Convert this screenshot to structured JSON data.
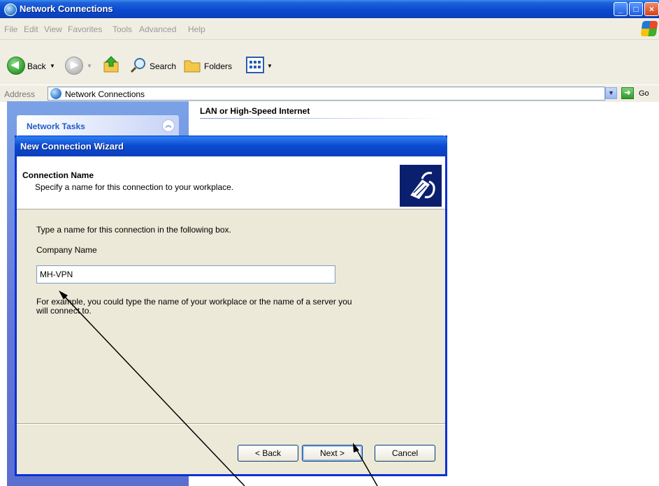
{
  "window": {
    "title": "Network Connections"
  },
  "menu": [
    "File",
    "Edit",
    "View",
    "Favorites",
    "Tools",
    "Advanced",
    "Help"
  ],
  "toolbar": {
    "back_label": "Back",
    "search_label": "Search",
    "folders_label": "Folders"
  },
  "address": {
    "label": "Address",
    "value": "Network Connections",
    "go_label": "Go"
  },
  "taskpane": {
    "header": "Network Tasks"
  },
  "content": {
    "section_heading": "LAN or High-Speed Internet"
  },
  "wizard": {
    "title": "New Connection Wizard",
    "header_title": "Connection Name",
    "header_subtitle": "Specify a name for this connection to your workplace.",
    "instruction": "Type a name for this connection in the following box.",
    "field_label": "Company Name",
    "field_value": "MH-VPN",
    "example_line1": "For example, you could type the name of your workplace or the name of a server you",
    "example_line2": "will connect to.",
    "back_label": "< Back",
    "next_label": "Next >",
    "cancel_label": "Cancel"
  }
}
